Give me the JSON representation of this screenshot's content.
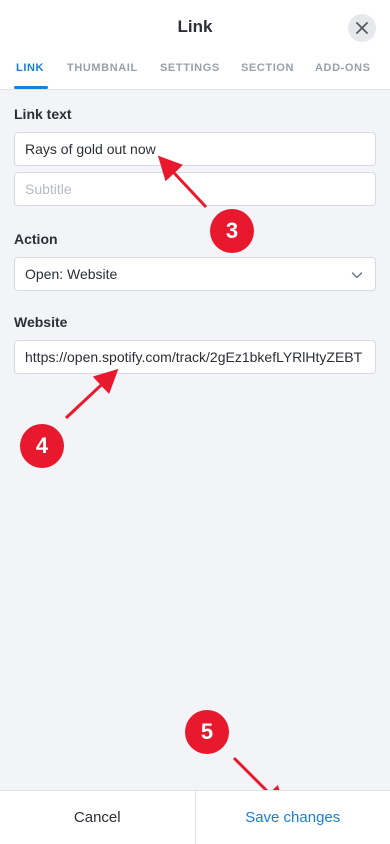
{
  "header": {
    "title": "Link",
    "tabs": [
      {
        "label": "LINK",
        "active": true
      },
      {
        "label": "THUMBNAIL",
        "active": false
      },
      {
        "label": "SETTINGS",
        "active": false
      },
      {
        "label": "SECTION",
        "active": false
      },
      {
        "label": "ADD-ONS",
        "active": false
      }
    ]
  },
  "form": {
    "link_text_label": "Link text",
    "link_text_value": "Rays of gold out now",
    "subtitle_placeholder": "Subtitle",
    "action_label": "Action",
    "action_value": "Open: Website",
    "website_label": "Website",
    "website_value": "https://open.spotify.com/track/2gEz1bkefLYRlHtyZEBT"
  },
  "annotations": {
    "badge_3": "3",
    "badge_4": "4",
    "badge_5": "5"
  },
  "footer": {
    "cancel_label": "Cancel",
    "save_label": "Save changes"
  },
  "colors": {
    "accent": "#1a7fd6",
    "annotation_red": "#e8192c",
    "background": "#f3f4f7"
  }
}
